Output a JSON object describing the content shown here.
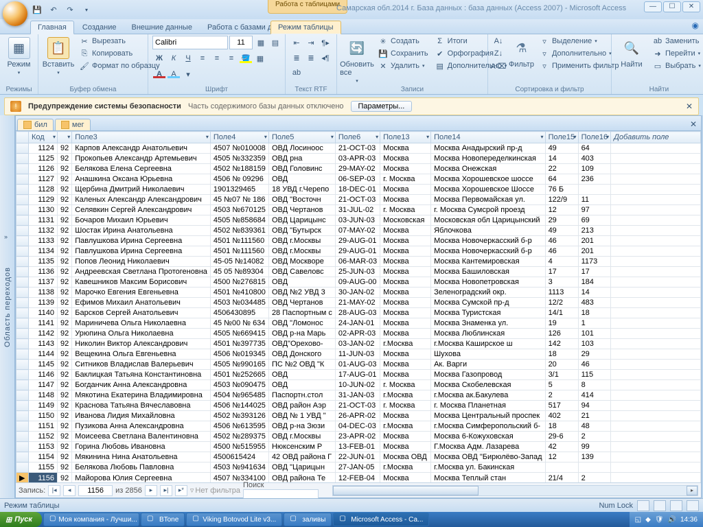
{
  "window": {
    "context_tool": "Работа с таблицами",
    "title": "Самарская обл.2014 г. База данных : база данных (Access 2007) - Microsoft Access"
  },
  "ribbon_tabs": {
    "home": "Главная",
    "create": "Создание",
    "external": "Внешние данные",
    "dbtools": "Работа с базами данных",
    "datasheet": "Режим таблицы"
  },
  "ribbon": {
    "views_group": "Режимы",
    "view_btn": "Режим",
    "clipboard_group": "Буфер обмена",
    "paste_btn": "Вставить",
    "cut": "Вырезать",
    "copy": "Копировать",
    "format_painter": "Формат по образцу",
    "font_group": "Шрифт",
    "font_name": "Calibri",
    "font_size": "11",
    "richtext_group": "Текст RTF",
    "records_group": "Записи",
    "refresh_btn": "Обновить все",
    "new": "Создать",
    "save": "Сохранить",
    "delete": "Удалить",
    "totals": "Итоги",
    "spelling": "Орфография",
    "more": "Дополнительно",
    "sortfilter_group": "Сортировка и фильтр",
    "filter_btn": "Фильтр",
    "selection": "Выделение",
    "advanced": "Дополнительно",
    "toggle_filter": "Применить фильтр",
    "find_group": "Найти",
    "find_btn": "Найти",
    "replace": "Заменить",
    "goto": "Перейти",
    "select": "Выбрать"
  },
  "security": {
    "title": "Предупреждение системы безопасности",
    "msg": "Часть содержимого базы данных отключено",
    "options": "Параметры..."
  },
  "navpane": "Область переходов",
  "tabs": {
    "t1": "бил",
    "t2": "мег"
  },
  "columns": {
    "c0": "Код",
    "c1": "",
    "c2": "Поле3",
    "c3": "Поле4",
    "c4": "Поле5",
    "c5": "Поле6",
    "c6": "Поле13",
    "c7": "Поле14",
    "c8": "Поле15",
    "c9": "Поле16",
    "add": "Добавить поле"
  },
  "rows": [
    {
      "c0": "1124",
      "c1": "92",
      "c2": "Карпов Александр Анатольевич",
      "c3": "4507 №010008",
      "c4": "ОВД Лосиноос",
      "c5": "21-OCT-03",
      "c6": "Москва",
      "c7": "Москва Анадырский пр-д",
      "c8": "49",
      "c9": "64"
    },
    {
      "c0": "1125",
      "c1": "92",
      "c2": "Прокопьев Александр Артемьевич",
      "c3": "4505 №332359",
      "c4": "ОВД рна",
      "c5": "03-APR-03",
      "c6": "Москва",
      "c7": "Москва Новопеределкинская",
      "c8": "14",
      "c9": "403"
    },
    {
      "c0": "1126",
      "c1": "92",
      "c2": "Белякова Елена Сергеевна",
      "c3": "4502 №188159",
      "c4": "ОВД Головинс",
      "c5": "29-MAY-02",
      "c6": "Москва",
      "c7": "Москва Онежская",
      "c8": "22",
      "c9": "109"
    },
    {
      "c0": "1127",
      "c1": "92",
      "c2": "Анашкина Оксана Юрьевна",
      "c3": "4506 № 09296",
      "c4": "ОВД",
      "c5": "06-SEP-03",
      "c6": "г. Москва",
      "c7": "Москва Хорошевское шоссе",
      "c8": "64",
      "c9": "236"
    },
    {
      "c0": "1128",
      "c1": "92",
      "c2": "Щербина Дмитрий Николаевич",
      "c3": "1901329465",
      "c4": "18 УВД г.Черепо",
      "c5": "18-DEC-01",
      "c6": "Москва",
      "c7": "Москва Хорошевское Шоссе",
      "c8": "76 Б",
      "c9": ""
    },
    {
      "c0": "1129",
      "c1": "92",
      "c2": "Каленых Александр Александрович",
      "c3": "45 №07 № 186",
      "c4": "ОВД \"Восточн",
      "c5": "21-OCT-03",
      "c6": "Москва",
      "c7": "Москва Первомайская ул.",
      "c8": "122/9",
      "c9": "11"
    },
    {
      "c0": "1130",
      "c1": "92",
      "c2": "Селявкин Сергей Александрович",
      "c3": "4503 №670125",
      "c4": "ОВД Чертанов",
      "c5": "31-JUL-02",
      "c6": "г. Москва",
      "c7": "г. Москва Сумсрой проезд",
      "c8": "12",
      "c9": "97"
    },
    {
      "c0": "1131",
      "c1": "92",
      "c2": "Бочаров Михаил Юрьевич",
      "c3": "4505 №858684",
      "c4": "ОВД Царицынс",
      "c5": "03-JUN-03",
      "c6": "Московская",
      "c7": "Московская обл Царицынский",
      "c8": "29",
      "c9": "69"
    },
    {
      "c0": "1132",
      "c1": "92",
      "c2": "Шостак Ирина Анатольевна",
      "c3": "4502 №839361",
      "c4": "ОВД \"Бутырск",
      "c5": "07-MAY-02",
      "c6": "Москва",
      "c7": "Яблочкова",
      "c8": "49",
      "c9": "213"
    },
    {
      "c0": "1133",
      "c1": "92",
      "c2": "Павлушкова Ирина Сергеевна",
      "c3": "4501 №111560",
      "c4": "ОВД г.Москвы",
      "c5": "29-AUG-01",
      "c6": "Москва",
      "c7": "Москва Новочеркасский б-р",
      "c8": "46",
      "c9": "201"
    },
    {
      "c0": "1134",
      "c1": "92",
      "c2": "Павлушкова Ирина Сергеевна",
      "c3": "4501 №111560",
      "c4": "ОВД г.Москвы",
      "c5": "29-AUG-01",
      "c6": "Москва",
      "c7": "Москва Новочеркасский б-р",
      "c8": "46",
      "c9": "201"
    },
    {
      "c0": "1135",
      "c1": "92",
      "c2": "Попов Леонид Николаевич",
      "c3": "45-05 №14082",
      "c4": "ОВД Москворе",
      "c5": "06-MAR-03",
      "c6": "Москва",
      "c7": "Москва Кантемировская",
      "c8": "4",
      "c9": "1173"
    },
    {
      "c0": "1136",
      "c1": "92",
      "c2": "Андреевская Светлана Протогеновна",
      "c3": "45 05 №89304",
      "c4": "ОВД Савеловс",
      "c5": "25-JUN-03",
      "c6": "Москва",
      "c7": "Москва Башиловская",
      "c8": "17",
      "c9": "17"
    },
    {
      "c0": "1137",
      "c1": "92",
      "c2": "Кавешников Максим Борисович",
      "c3": "4500 №276815",
      "c4": "ОВД",
      "c5": "09-AUG-00",
      "c6": "Москва",
      "c7": "Москва Новопетровская",
      "c8": "3",
      "c9": "184"
    },
    {
      "c0": "1138",
      "c1": "92",
      "c2": "Марочко Евгения Евгеньевна",
      "c3": "4501 №410800",
      "c4": "ОВД №2 УВД 3",
      "c5": "30-JAN-02",
      "c6": "Москва",
      "c7": "Зеленоградский окр.",
      "c8": "1113",
      "c9": "14"
    },
    {
      "c0": "1139",
      "c1": "92",
      "c2": "Ефимов Михаил Анатольевич",
      "c3": "4503 №034485",
      "c4": "ОВД Чертанов",
      "c5": "21-MAY-02",
      "c6": "Москва",
      "c7": "Москва Сумской пр-д",
      "c8": "12/2",
      "c9": "483"
    },
    {
      "c0": "1140",
      "c1": "92",
      "c2": "Барсков Сергей Анатольевич",
      "c3": "4506430895",
      "c4": "28 Паспортным с",
      "c5": "28-AUG-03",
      "c6": "Москва",
      "c7": "Москва Туристская",
      "c8": "14/1",
      "c9": "18"
    },
    {
      "c0": "1141",
      "c1": "92",
      "c2": "Мариничева Ольга Николаевна",
      "c3": "45 №00 № 634",
      "c4": "ОВД \"Ломонос",
      "c5": "24-JAN-01",
      "c6": "Москва",
      "c7": "Москва Знаменка ул.",
      "c8": "19",
      "c9": "1"
    },
    {
      "c0": "1142",
      "c1": "92",
      "c2": "Урюпина Ольга Николаевна",
      "c3": "4505 №669415",
      "c4": "ОВД р-на Марь",
      "c5": "02-APR-03",
      "c6": "Москва",
      "c7": "Москва Люблинская",
      "c8": "126",
      "c9": "101"
    },
    {
      "c0": "1143",
      "c1": "92",
      "c2": "Николин Виктор Александрович",
      "c3": "4501 №397735",
      "c4": "ОВД\"Орехово-",
      "c5": "03-JAN-02",
      "c6": "г.Москва",
      "c7": "г.Москва Каширское ш",
      "c8": "142",
      "c9": "103"
    },
    {
      "c0": "1144",
      "c1": "92",
      "c2": "Вещекина Ольга Евгеньевна",
      "c3": "4506 №019345",
      "c4": "ОВД Донского",
      "c5": "11-JUN-03",
      "c6": "Москва",
      "c7": "Шухова",
      "c8": "18",
      "c9": "29"
    },
    {
      "c0": "1145",
      "c1": "92",
      "c2": "Ситников Владислав Валерьевич",
      "c3": "4505 №990165",
      "c4": "ПС №2 ОВД \"К",
      "c5": "01-AUG-03",
      "c6": "Москва",
      "c7": "Ак. Варги",
      "c8": "20",
      "c9": "46"
    },
    {
      "c0": "1146",
      "c1": "92",
      "c2": "Баклицкая Татьяна Константиновна",
      "c3": "4501 №252665",
      "c4": "ОВД",
      "c5": "17-AUG-01",
      "c6": "Москва",
      "c7": "Москва Газопровод",
      "c8": "3/1",
      "c9": "115"
    },
    {
      "c0": "1147",
      "c1": "92",
      "c2": "Богданчик Анна Александровна",
      "c3": "4503 №090475",
      "c4": "ОВД",
      "c5": "10-JUN-02",
      "c6": "г. Москва",
      "c7": "Москва Скобелевская",
      "c8": "5",
      "c9": "8"
    },
    {
      "c0": "1148",
      "c1": "92",
      "c2": "Мякотина Екатерина Владимировна",
      "c3": "4504 №965485",
      "c4": "Паспортн.стол",
      "c5": "31-JAN-03",
      "c6": "г.Москва",
      "c7": "г.Москва ак.Бакулева",
      "c8": "2",
      "c9": "414"
    },
    {
      "c0": "1149",
      "c1": "92",
      "c2": "Краснова Татьяна Вячеславовна",
      "c3": "4506 №144025",
      "c4": "ОВД район Аэр",
      "c5": "21-OCT-03",
      "c6": "г. Москва",
      "c7": "г. Москва Планетная",
      "c8": "517",
      "c9": "94"
    },
    {
      "c0": "1150",
      "c1": "92",
      "c2": "Иванова Лидия Михайловна",
      "c3": "4502 №393126",
      "c4": "ОВД № 1 УВД \"",
      "c5": "26-APR-02",
      "c6": "Москва",
      "c7": "Москва Центральный проспек",
      "c8": "402",
      "c9": "21"
    },
    {
      "c0": "1151",
      "c1": "92",
      "c2": "Пузикова Анна Александровна",
      "c3": "4506 №613595",
      "c4": "ОВД р-на Зюзи",
      "c5": "04-DEC-03",
      "c6": "г.Москва",
      "c7": "г.Москва Симферопольский б-",
      "c8": "18",
      "c9": "48"
    },
    {
      "c0": "1152",
      "c1": "92",
      "c2": "Моисеева Светлана Валентиновна",
      "c3": "4502 №289375",
      "c4": "ОВД г.Москвы",
      "c5": "23-APR-02",
      "c6": "Москва",
      "c7": "Москва 6-Кожуховская",
      "c8": "29-6",
      "c9": "2"
    },
    {
      "c0": "1153",
      "c1": "92",
      "c2": "Горина Любовь Ивановна",
      "c3": "4500 №515955",
      "c4": "Нюксенским Р",
      "c5": "13-FEB-01",
      "c6": "Москва",
      "c7": "Г.Москва Адм. Лазарева",
      "c8": "42",
      "c9": "99"
    },
    {
      "c0": "1154",
      "c1": "92",
      "c2": "Мякинина Нина Анатольевна",
      "c3": "4500615424",
      "c4": "42 ОВД района Г",
      "c5": "22-JUN-01",
      "c6": "Москва ОВД",
      "c7": "Москва ОВД \"Бирюлёво-Запад",
      "c8": "12",
      "c9": "139"
    },
    {
      "c0": "1155",
      "c1": "92",
      "c2": "Белякова Любовь Павловна",
      "c3": "4503 №941634",
      "c4": "ОВД \"Царицын",
      "c5": "27-JAN-05",
      "c6": "г.Москва",
      "c7": "г.Москва ул. Бакинская",
      "c8": "",
      "c9": ""
    },
    {
      "c0": "1156",
      "c1": "92",
      "c2": "Майорова Юлия Сергеевна",
      "c3": "4507 №334100",
      "c4": "ОВД района Те",
      "c5": "12-FEB-04",
      "c6": "Москва",
      "c7": "Москва Теплый стан",
      "c8": "21/4",
      "c9": "2"
    }
  ],
  "recnav": {
    "label": "Запись:",
    "current": "1156",
    "of": "из 2856",
    "nofilter": "Нет фильтра",
    "search_label": "Поиск"
  },
  "statusbar": {
    "mode": "Режим таблицы",
    "numlock": "Num Lock"
  },
  "taskbar": {
    "start": "Пуск",
    "items": [
      "Моя компания - Лучши...",
      "BTone",
      "Viking Botovod Lite    v3...",
      "заливы",
      "Microsoft Access - Са..."
    ],
    "clock": "14:36"
  }
}
